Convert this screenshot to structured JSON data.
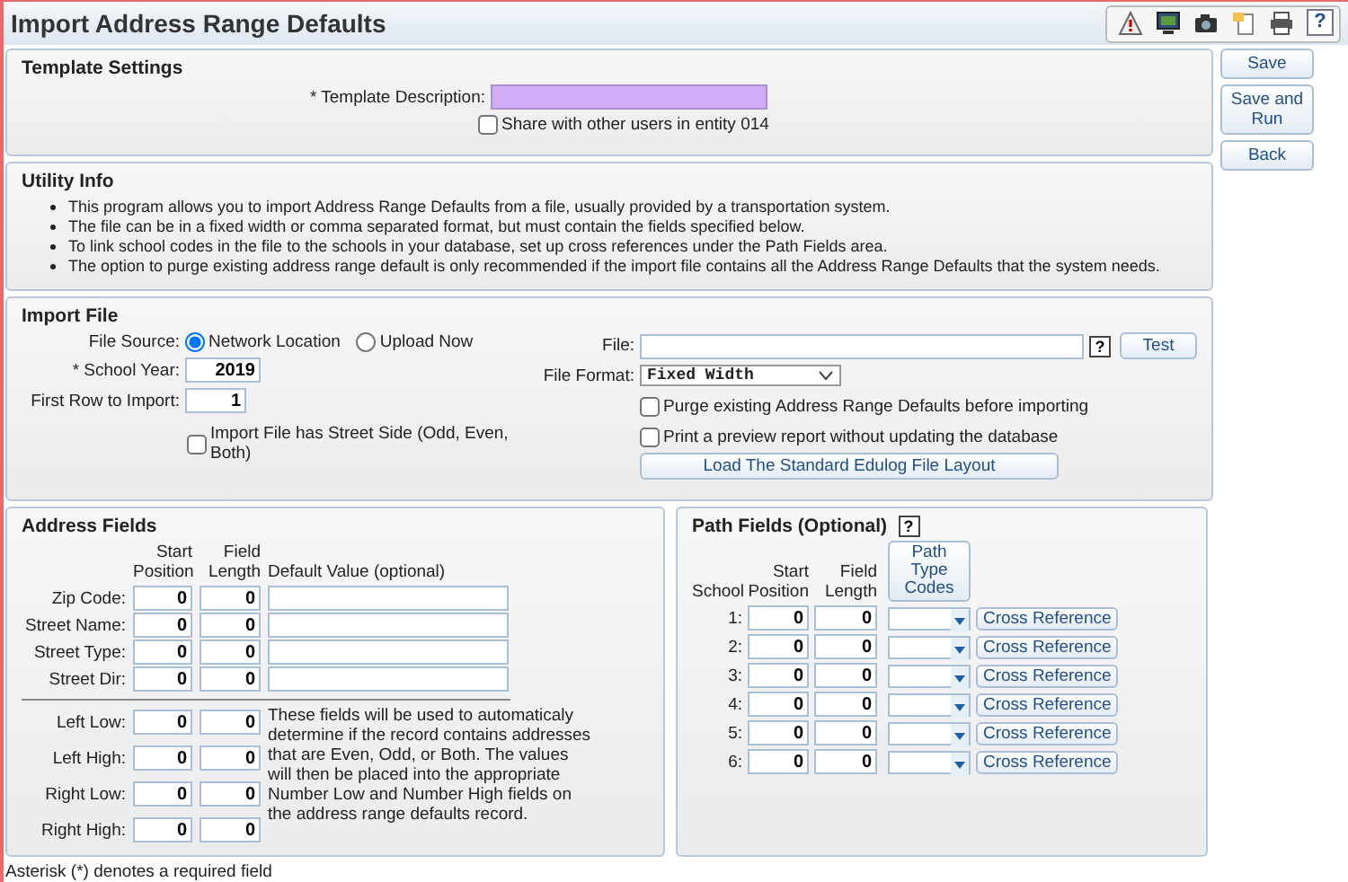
{
  "title": "Import Address Range Defaults",
  "toolbar_help": "?",
  "side_buttons": [
    "Save",
    "Save and Run",
    "Back"
  ],
  "template_settings": {
    "heading": "Template Settings",
    "description_label": "* Template Description:",
    "share_label": "Share with other users in entity 014",
    "share_checked": false
  },
  "utility_info": {
    "heading": "Utility Info",
    "items": [
      "This program allows you to import Address Range Defaults from a file, usually provided by a transportation system.",
      "The file can be in a fixed width or comma separated format, but must contain the fields specified below.",
      "To link school codes in the file to the schools in your database, set up cross references under the Path Fields area.",
      "The option to purge existing address range default is only recommended if the import file contains all the Address Range Defaults that the system needs."
    ]
  },
  "import_file": {
    "heading": "Import File",
    "file_source_label": "File Source:",
    "sources": [
      {
        "label": "Network Location",
        "selected": true
      },
      {
        "label": "Upload Now",
        "selected": false
      }
    ],
    "school_year_label": "* School Year:",
    "school_year": "2019",
    "first_row_label": "First Row to Import:",
    "first_row": "1",
    "street_side_label": "Import File has Street Side (Odd, Even, Both)",
    "street_side_checked": false,
    "file_label": "File:",
    "help": "?",
    "test_button": "Test",
    "file_format_label": "File Format:",
    "file_format": "Fixed Width",
    "options": [
      {
        "label": "Purge existing Address Range Defaults before importing",
        "checked": false
      },
      {
        "label": "Print a preview report without updating the database",
        "checked": false
      }
    ],
    "load_button": "Load The Standard Edulog File Layout"
  },
  "address_fields": {
    "heading": "Address Fields",
    "columns": [
      "Start Position",
      "Field Length",
      "Default Value (optional)"
    ],
    "rows": [
      {
        "label": "Zip Code:",
        "start": "0",
        "length": "0"
      },
      {
        "label": "Street Name:",
        "start": "0",
        "length": "0"
      },
      {
        "label": "Street Type:",
        "start": "0",
        "length": "0"
      },
      {
        "label": "Street Dir:",
        "start": "0",
        "length": "0"
      }
    ],
    "side_rows": [
      {
        "label": "Left Low:",
        "start": "0",
        "length": "0"
      },
      {
        "label": "Left High:",
        "start": "0",
        "length": "0"
      },
      {
        "label": "Right Low:",
        "start": "0",
        "length": "0"
      },
      {
        "label": "Right High:",
        "start": "0",
        "length": "0"
      }
    ],
    "note": "These fields will be used to automaticaly determine if the record contains addresses that are Even, Odd, or Both. The values will then be placed into the appropriate Number Low and Number High fields on the address range defaults record."
  },
  "path_fields": {
    "heading": "Path Fields (Optional)",
    "help": "?",
    "columns": [
      "School",
      "Start Position",
      "Field Length"
    ],
    "codes_button": "Path Type Codes",
    "rows": [
      {
        "school": "1:",
        "start": "0",
        "length": "0",
        "button": "Cross Reference"
      },
      {
        "school": "2:",
        "start": "0",
        "length": "0",
        "button": "Cross Reference"
      },
      {
        "school": "3:",
        "start": "0",
        "length": "0",
        "button": "Cross Reference"
      },
      {
        "school": "4:",
        "start": "0",
        "length": "0",
        "button": "Cross Reference"
      },
      {
        "school": "5:",
        "start": "0",
        "length": "0",
        "button": "Cross Reference"
      },
      {
        "school": "6:",
        "start": "0",
        "length": "0",
        "button": "Cross Reference"
      }
    ]
  },
  "footnote": "Asterisk (*) denotes a required field"
}
